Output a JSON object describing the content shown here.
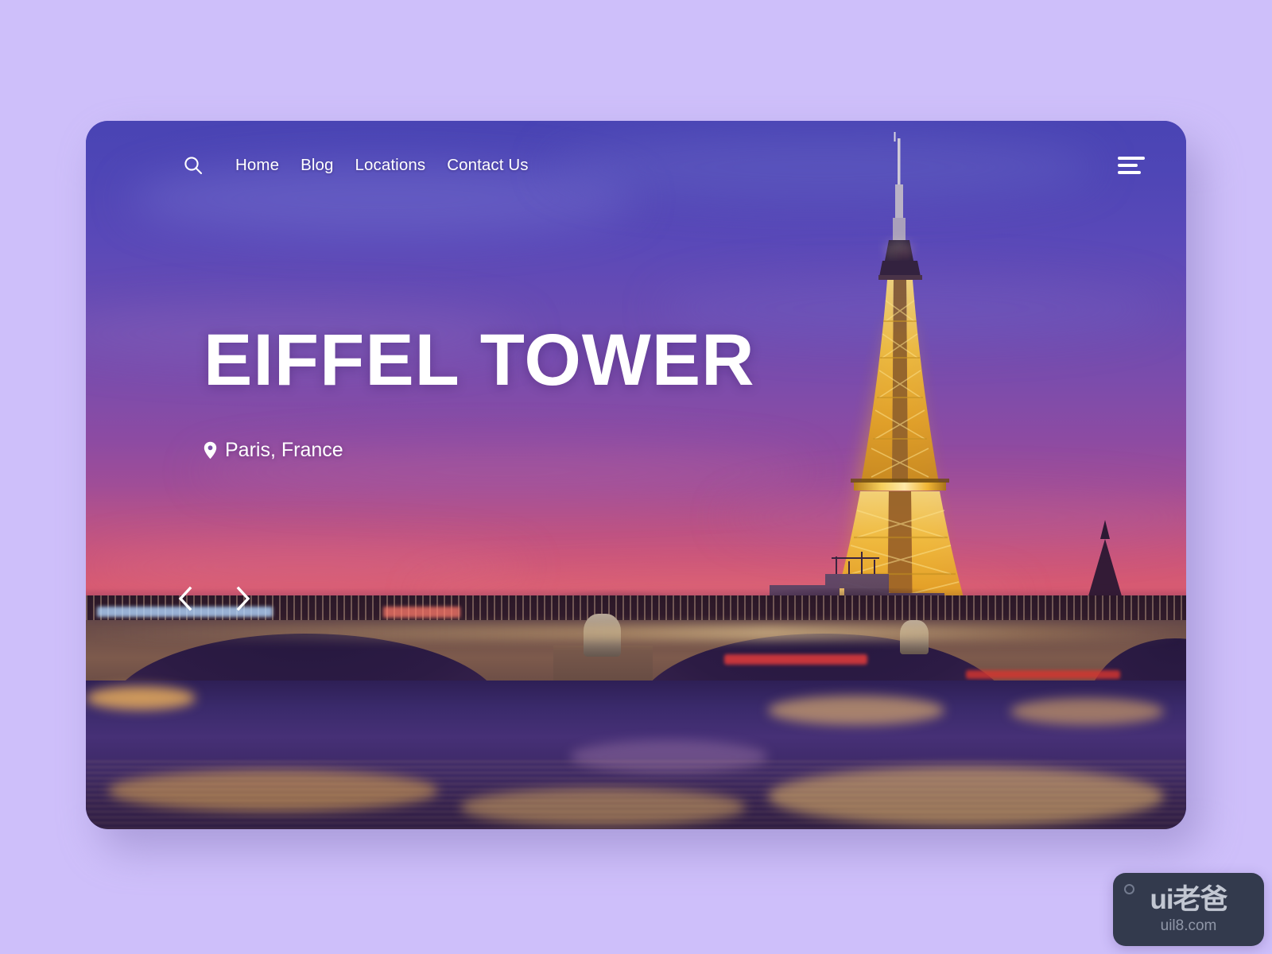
{
  "page": {
    "background_color": "#cebffa",
    "card": {
      "radius": "28px",
      "base_color": "#3f3aa8"
    }
  },
  "navbar": {
    "search_icon": "search-icon",
    "menu_icon": "hamburger-menu-icon",
    "links": [
      {
        "label": "Home"
      },
      {
        "label": "Blog"
      },
      {
        "label": "Locations"
      },
      {
        "label": "Contact Us"
      }
    ]
  },
  "hero": {
    "title": "EIFFEL TOWER",
    "location_icon": "map-pin-icon",
    "location": "Paris, France",
    "title_color": "#ffffff"
  },
  "carousel": {
    "prev_icon": "chevron-left-icon",
    "next_icon": "chevron-right-icon"
  },
  "scene": {
    "subject": "Eiffel Tower at dusk over the Seine",
    "sky_top_color": "#4944b4",
    "sky_horizon_color": "#d75a72",
    "tower_light_color": "#f5c544",
    "river_color": "#463076"
  },
  "watermark": {
    "brand": "ui老爸",
    "site": "uil8.com",
    "badge_color": "#333a4d"
  }
}
